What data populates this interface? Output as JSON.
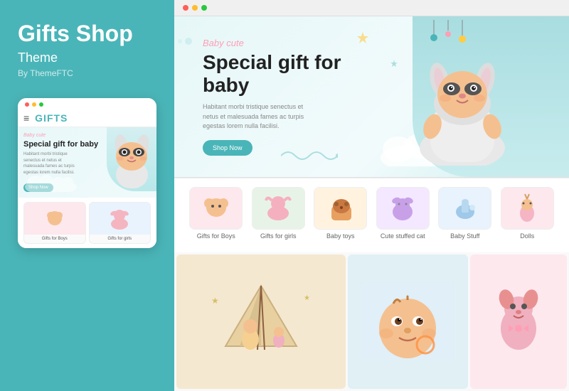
{
  "leftPanel": {
    "title": "Gifts Shop",
    "subtitle": "Theme",
    "byLine": "By ThemeFTC",
    "dots": [
      "red",
      "yellow",
      "green"
    ],
    "mobileNav": {
      "hamburger": "≡",
      "logo": "GIFTS"
    },
    "mobileHero": {
      "tag": "Baby cute",
      "title": "Special gift for baby",
      "description": "Habitant morbi tristique senectus et netus et malesuada fames ac turpis egestas lorem nulla facilisi.",
      "shopButton": "Shop Now"
    },
    "mobileProducts": [
      {
        "label": "Gifts for Boys",
        "emoji": "👦"
      },
      {
        "label": "Gifts for girls",
        "emoji": "🎀"
      }
    ]
  },
  "rightPanel": {
    "browserDots": [
      "red",
      "yellow",
      "green"
    ],
    "hero": {
      "tag": "Baby cute",
      "title": "Special gift for baby",
      "description": "Habitant morbi tristique senectus et netus et malesuada fames ac turpis egestas lorem nulla facilisi.",
      "shopButton": "Shop Now"
    },
    "products": [
      {
        "label": "Gifts for Boys",
        "emoji": "👦",
        "class": "p1"
      },
      {
        "label": "Gifts for girls",
        "emoji": "🎀",
        "class": "p2"
      },
      {
        "label": "Baby toys",
        "emoji": "🧸",
        "class": "p3"
      },
      {
        "label": "Cute stuffed cat",
        "emoji": "🐱",
        "class": "p4"
      },
      {
        "label": "Baby Stuff",
        "emoji": "🍼",
        "class": "p5"
      },
      {
        "label": "Dolls",
        "emoji": "🪆",
        "class": "p6"
      }
    ],
    "gallery": [
      {
        "emoji": "🎪",
        "class": "g1"
      },
      {
        "emoji": "👶",
        "class": "g2"
      },
      {
        "emoji": "🧸",
        "class": "g3"
      }
    ]
  }
}
